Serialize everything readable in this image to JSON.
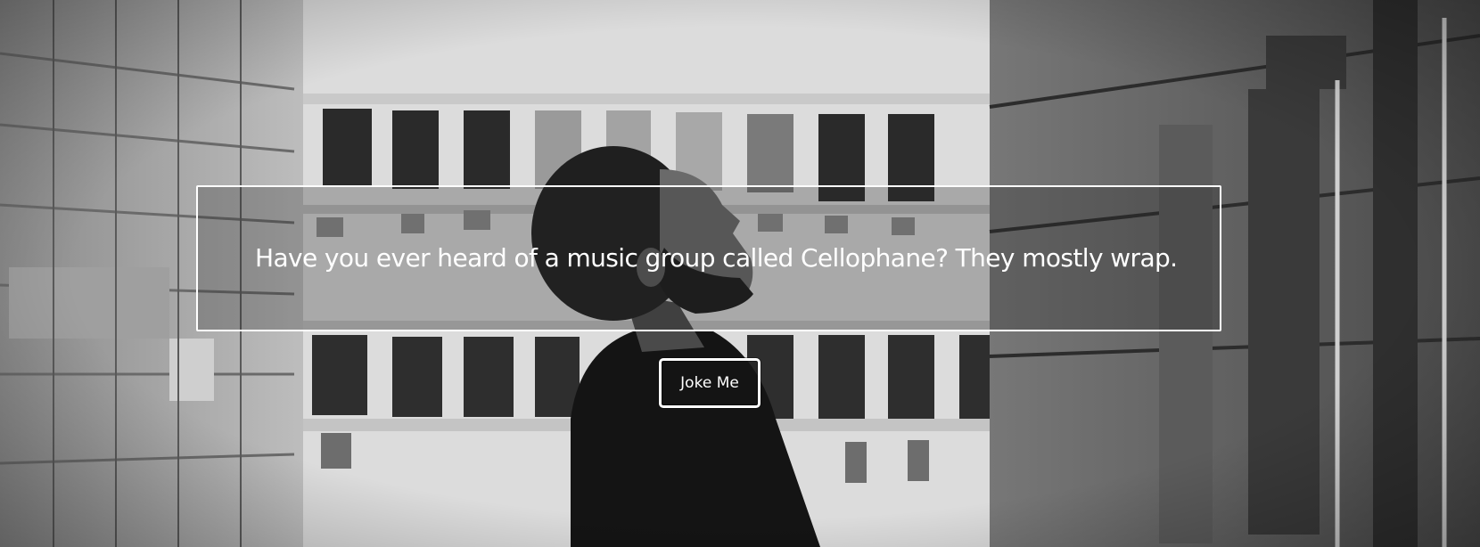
{
  "joke": {
    "text": "Have you ever heard of a music group called Cellophane? They mostly wrap."
  },
  "button": {
    "label": "Joke Me"
  },
  "background": {
    "image": "grayscale-street-photo",
    "tone": "black-and-white"
  }
}
